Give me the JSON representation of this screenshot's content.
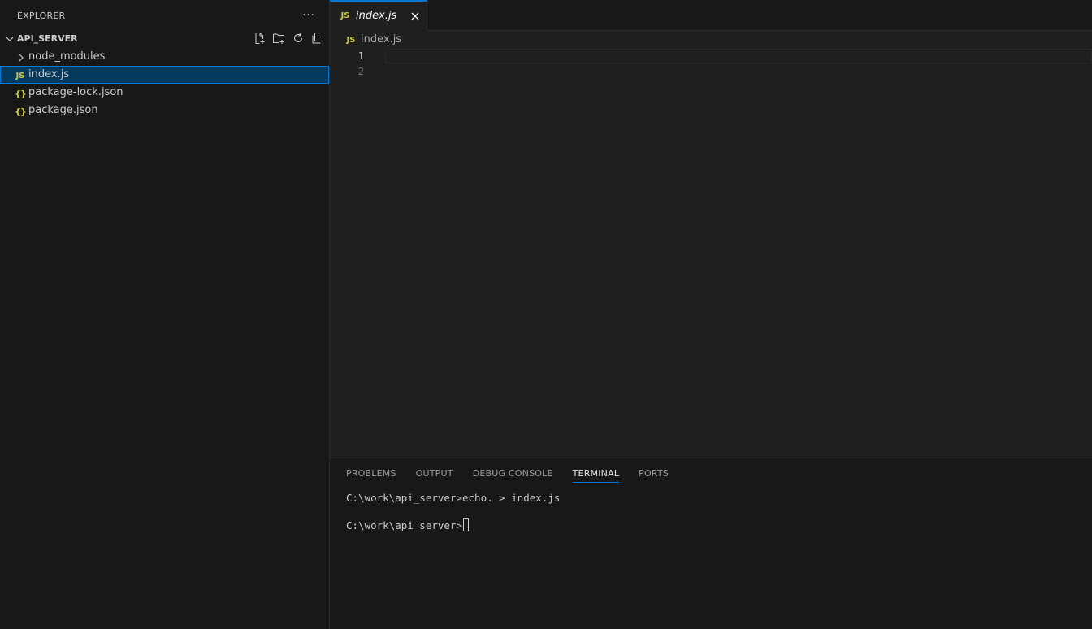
{
  "sidebar": {
    "title": "EXPLORER",
    "more_glyph": "···",
    "folder": {
      "name": "API_SERVER"
    },
    "items": [
      {
        "label": "node_modules",
        "type": "folder",
        "selected": false
      },
      {
        "label": "index.js",
        "type": "js",
        "selected": true
      },
      {
        "label": "package-lock.json",
        "type": "json",
        "selected": false
      },
      {
        "label": "package.json",
        "type": "json",
        "selected": false
      }
    ]
  },
  "icons": {
    "js_glyph": "JS",
    "json_glyph": "{}"
  },
  "editor": {
    "tabs": [
      {
        "label": "index.js",
        "active": true,
        "preview": true
      }
    ],
    "breadcrumb": {
      "file": "index.js"
    },
    "lines": [
      {
        "number": "1",
        "text": ""
      },
      {
        "number": "2",
        "text": ""
      }
    ]
  },
  "panel": {
    "tabs": [
      {
        "label": "PROBLEMS",
        "active": false
      },
      {
        "label": "OUTPUT",
        "active": false
      },
      {
        "label": "DEBUG CONSOLE",
        "active": false
      },
      {
        "label": "TERMINAL",
        "active": true
      },
      {
        "label": "PORTS",
        "active": false
      }
    ],
    "terminal": {
      "line1": "C:\\work\\api_server>echo. > index.js",
      "prompt": "C:\\work\\api_server>"
    }
  },
  "colors": {
    "accent": "#0078d4",
    "selection_bg": "#04395e",
    "js_icon": "#cbcb41",
    "json_icon": "#cbcb41"
  }
}
